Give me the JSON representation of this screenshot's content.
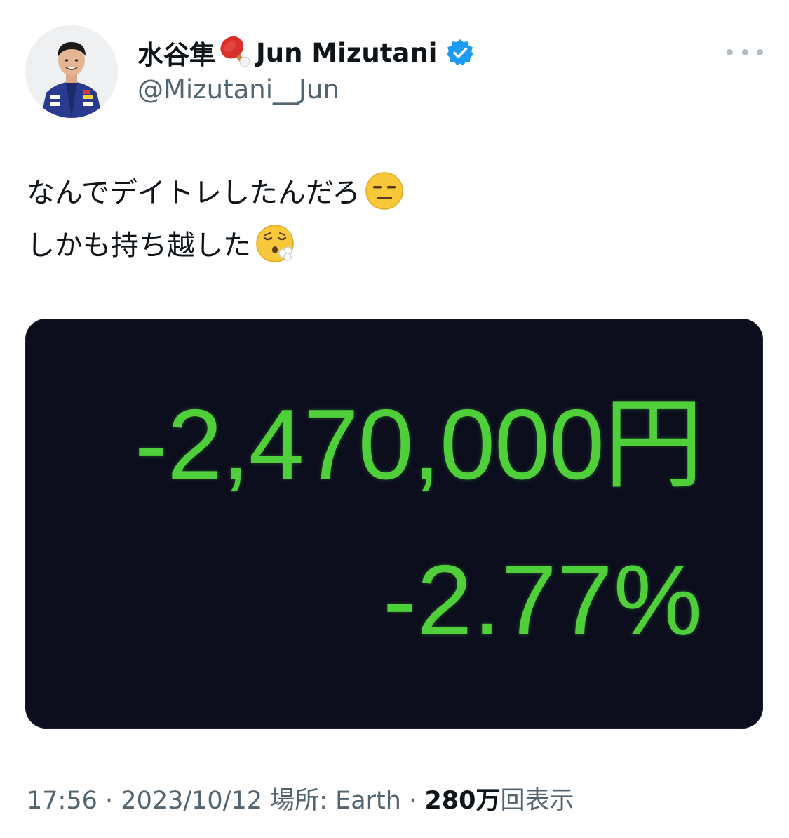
{
  "author": {
    "display_name": "水谷隼",
    "display_name_suffix": "Jun Mizutani",
    "handle": "@Mizutani__Jun",
    "verified": true,
    "name_icon": "ping-pong-paddle-icon",
    "avatar_icon": "profile-photo-avatar"
  },
  "tweet": {
    "line1": "なんでデイトレしたんだろ",
    "line1_emoji": "expressionless-face-emoji",
    "line2": "しかも持ち越した",
    "line2_emoji": "face-exhaling-emoji"
  },
  "media": {
    "amount": "-2,470,000円",
    "percent": "-2.77%",
    "background_color": "#0c0e1e",
    "text_color": "#4fcf3a"
  },
  "meta": {
    "time": "17:56",
    "separator": "·",
    "date": "2023/10/12",
    "location_label": "場所: Earth",
    "views_count": "280万",
    "views_label": "回表示"
  },
  "colors": {
    "primary_text": "#0f1419",
    "secondary_text": "#536471",
    "verified_badge": "#1d9bf0"
  }
}
